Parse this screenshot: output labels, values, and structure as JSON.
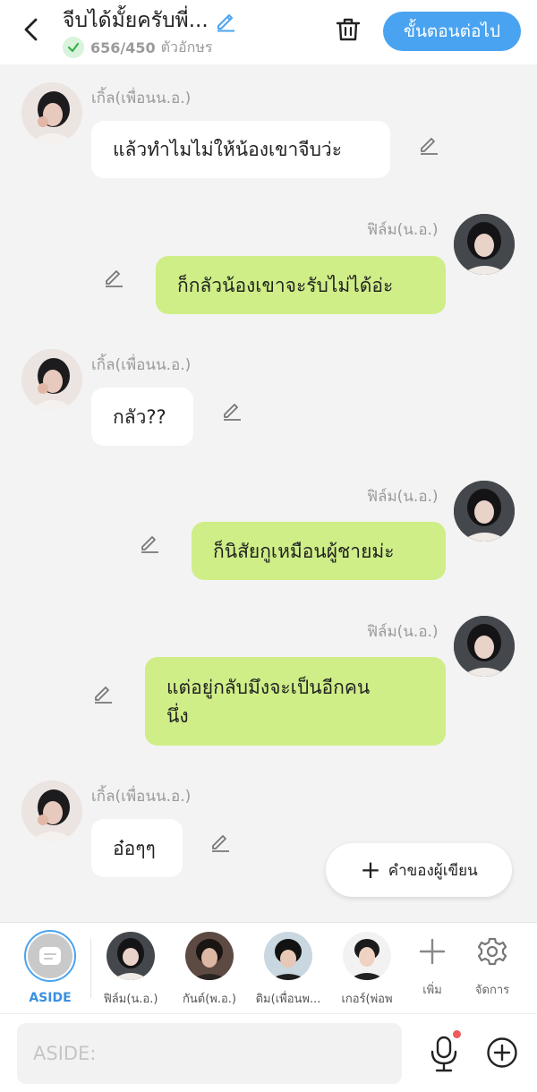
{
  "header": {
    "title": "จีบได้มั้ยครับพี่...",
    "char_count": "656/450",
    "char_unit": "ตัวอักษร",
    "next_label": "ขั้นตอนต่อไป",
    "accent_color": "#4aa3f0"
  },
  "messages": [
    {
      "side": "left",
      "sender": "เกิ้ล(เพื่อนน.อ.)",
      "text": "แล้วทำไมไม่ให้น้องเขาจีบว่ะ"
    },
    {
      "side": "right",
      "sender": "ฟิล์ม(น.อ.)",
      "text": "ก็กลัวน้องเขาจะรับไม่ได้อ่ะ"
    },
    {
      "side": "left",
      "sender": "เกิ้ล(เพื่อนน.อ.)",
      "text": "กลัว??"
    },
    {
      "side": "right",
      "sender": "ฟิล์ม(น.อ.)",
      "text": "ก็นิสัยกูเหมือนผู้ชายม่ะ"
    },
    {
      "side": "right",
      "sender": "ฟิล์ม(น.อ.)",
      "text_line1": "แต่อยู่กลับมึงจะเป็นอีกคน",
      "text_line2": "นึ่ง"
    },
    {
      "side": "left",
      "sender": "เกิ้ล(เพื่อนน.อ.)",
      "text": "อ๋อๆๆ"
    }
  ],
  "fab": {
    "label": "คำของผู้เขียน",
    "icon": "plus-icon"
  },
  "character_bar": {
    "aside_label": "ASIDE",
    "characters": [
      {
        "name": "ฟิล์ม(น.อ.)"
      },
      {
        "name": "กันต์(พ.อ.)"
      },
      {
        "name": "ติม(เพื่อนพ..."
      },
      {
        "name": "เกอร์(พ่อพ"
      }
    ],
    "add_label": "เพิ่ม",
    "manage_label": "จัดการ"
  },
  "input": {
    "placeholder": "ASIDE:",
    "value": ""
  },
  "colors": {
    "green_bubble": "#cfee87",
    "white_bubble": "#ffffff",
    "background": "#f3f3f3",
    "notification_dot": "#ef5a5a"
  }
}
